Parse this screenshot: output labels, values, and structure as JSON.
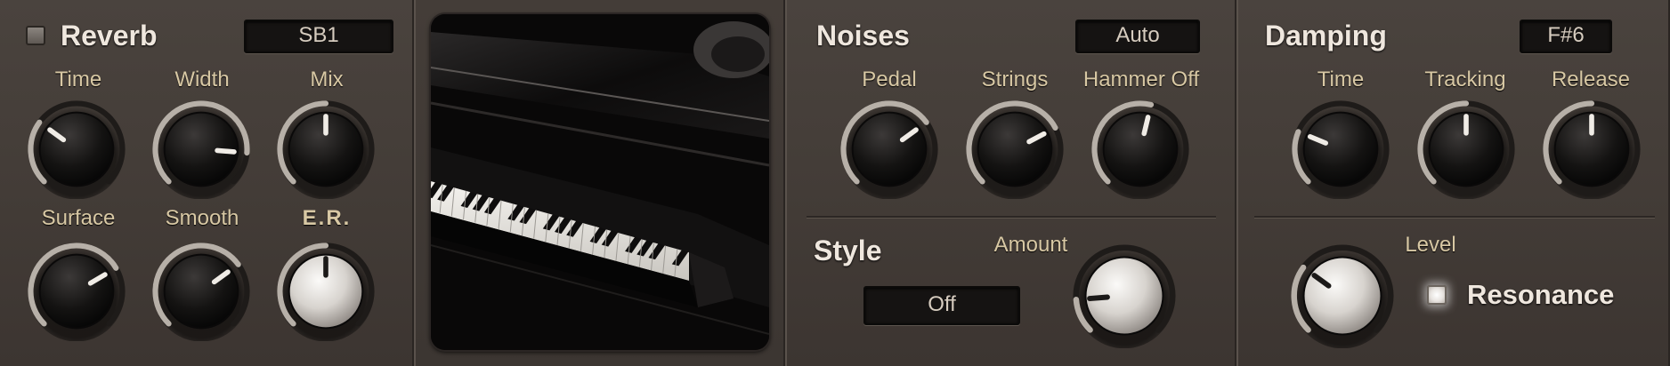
{
  "reverb": {
    "title": "Reverb",
    "preset": "SB1",
    "knobs": [
      {
        "label": "Time",
        "value": 0.3
      },
      {
        "label": "Width",
        "value": 0.85
      },
      {
        "label": "Mix",
        "value": 0.5
      },
      {
        "label": "Surface",
        "value": 0.72
      },
      {
        "label": "Smooth",
        "value": 0.7
      },
      {
        "label": "E.R.",
        "value": 0.5
      }
    ]
  },
  "noises": {
    "title": "Noises",
    "mode": "Auto",
    "knobs": [
      {
        "label": "Pedal",
        "value": 0.7
      },
      {
        "label": "Strings",
        "value": 0.73
      },
      {
        "label": "Hammer Off",
        "value": 0.55
      }
    ],
    "style": {
      "title": "Style",
      "value": "Off",
      "amount_label": "Amount",
      "amount": 0.15
    }
  },
  "damping": {
    "title": "Damping",
    "note": "F#6",
    "knobs": [
      {
        "label": "Time",
        "value": 0.25
      },
      {
        "label": "Tracking",
        "value": 0.5
      },
      {
        "label": "Release",
        "value": 0.5
      }
    ],
    "level_label": "Level",
    "level": 0.3,
    "resonance_label": "Resonance"
  },
  "icons": {
    "reverb_toggle": "led-toggle-icon",
    "resonance_toggle": "led-toggle-icon",
    "piano": "grand-piano-image"
  },
  "colors": {
    "panel": "#443d38",
    "label": "#d8c8a4",
    "title": "#efe7de",
    "display_bg": "#151312"
  }
}
